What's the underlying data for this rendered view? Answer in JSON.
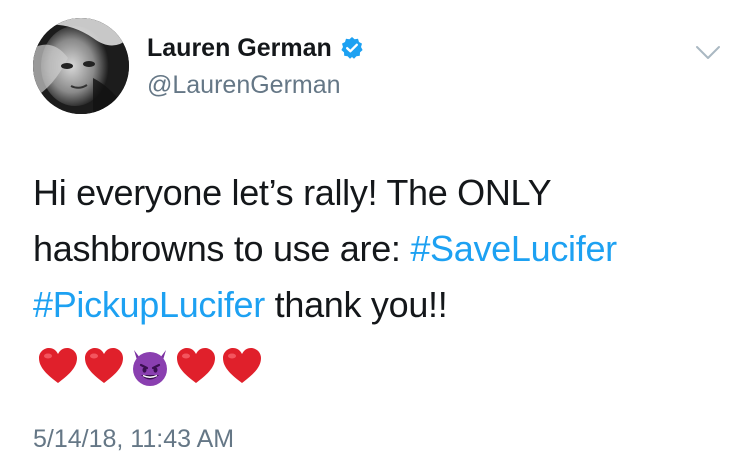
{
  "author": {
    "display_name": "Lauren German",
    "handle": "@LaurenGerman",
    "verified": true
  },
  "tweet": {
    "line1": "Hi everyone let’s rally! The ONLY",
    "line2_text": "hashbrowns to use are: ",
    "hashtag1": "#SaveLucifer",
    "hashtag2": "#PickupLucifer",
    "line3_text": " thank you!!",
    "emojis": [
      "red-heart",
      "red-heart",
      "smiling-imp",
      "red-heart",
      "red-heart"
    ]
  },
  "timestamp": "5/14/18, 11:43 AM",
  "colors": {
    "link": "#1da1f2",
    "secondary_text": "#657786",
    "primary_text": "#14171a",
    "verified_badge": "#1da1f2",
    "heart": "#e0202b",
    "imp": "#8a3fb0"
  },
  "icons": {
    "verified": "verified-badge-icon",
    "menu": "chevron-down-icon"
  }
}
